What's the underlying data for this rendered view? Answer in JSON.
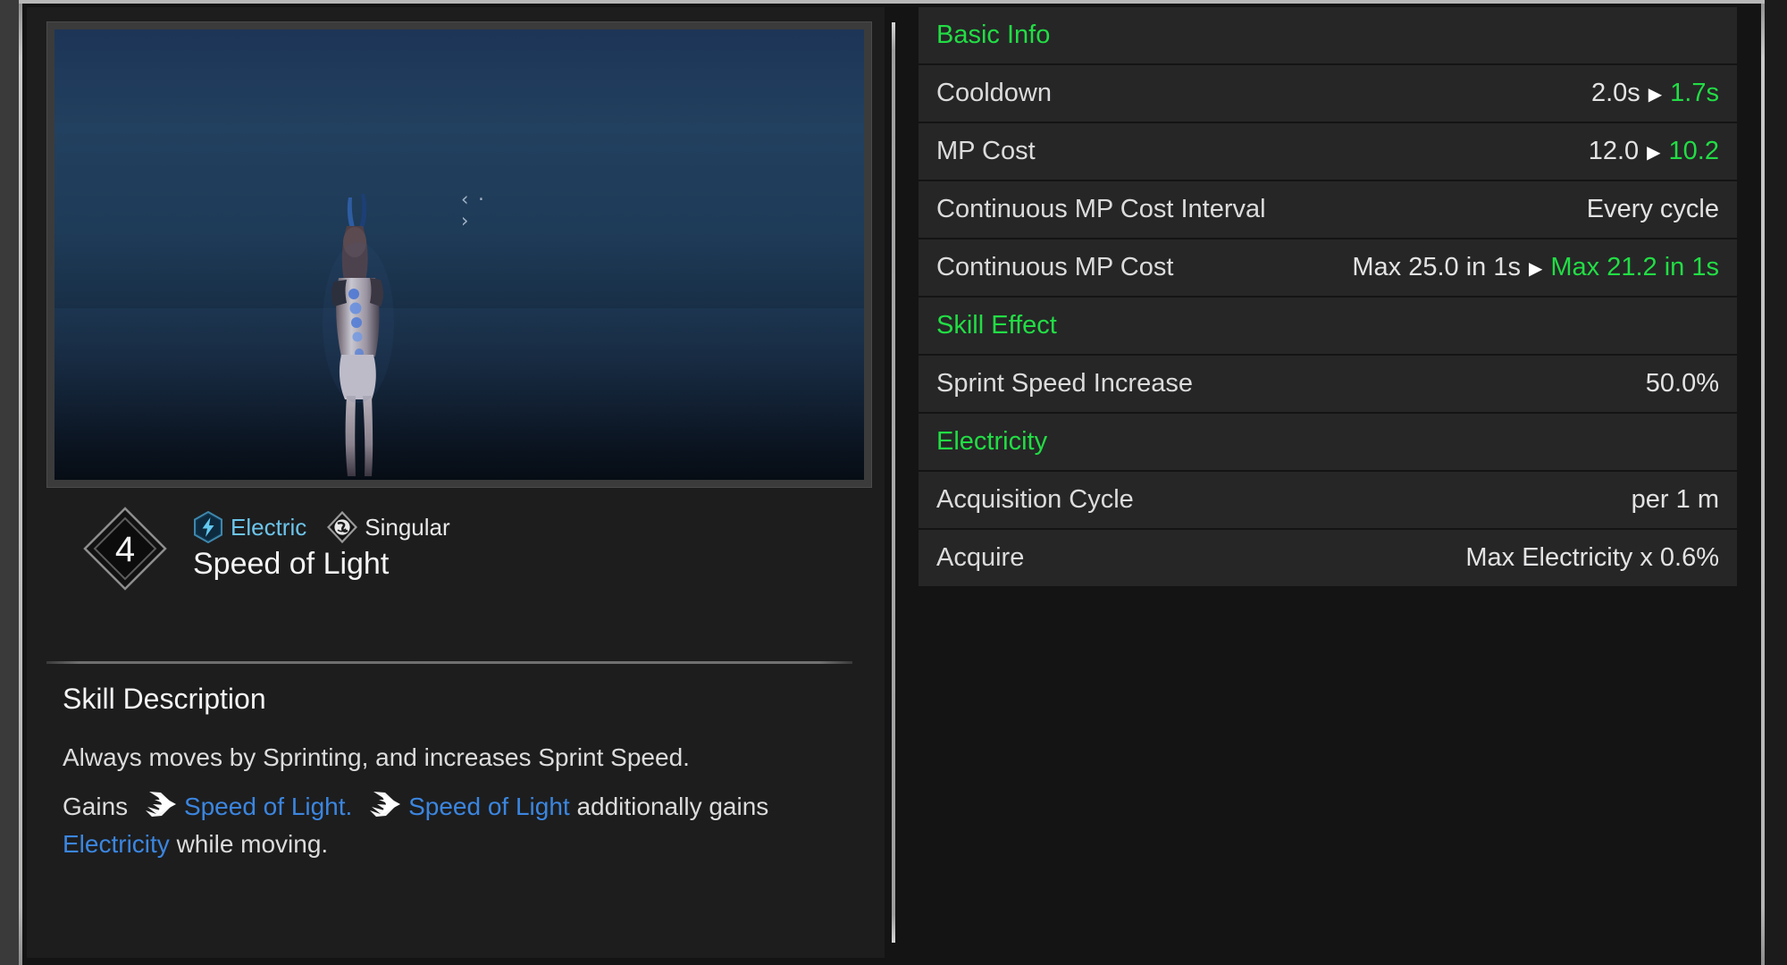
{
  "preview": {
    "name": "skill-preview-video",
    "reticle": "‹ · ›",
    "background_top": "#1d3557",
    "background_bottom": "#070d15"
  },
  "skill": {
    "rank": "4",
    "title": "Speed of Light",
    "tags": [
      {
        "icon": "electric-hexagon-icon",
        "label": "Electric",
        "color": "#6cc4ea"
      },
      {
        "icon": "singular-diamond-icon",
        "label": "Singular",
        "color": "#e9e9e9"
      }
    ],
    "description_heading": "Skill Description",
    "paragraph_1": "Always moves by Sprinting, and increases Sprint Speed.",
    "paragraph_2": {
      "prefix": "Gains",
      "buff_1": "Speed of Light.",
      "buff_2": "Speed of Light",
      "middle": "additionally gains",
      "keyword": "Electricity",
      "suffix": "while moving."
    }
  },
  "colors": {
    "section_green": "#22dd44",
    "link_blue": "#3b86e0",
    "electric_blue": "#6cc4ea",
    "row_background": "#262627",
    "panel_background": "#1d1d1e"
  },
  "stats": [
    {
      "type": "section",
      "label": "Basic Info",
      "value": "",
      "value_new": ""
    },
    {
      "type": "row",
      "label": "Cooldown",
      "value": "2.0s",
      "value_new": "1.7s"
    },
    {
      "type": "row",
      "label": "MP Cost",
      "value": "12.0",
      "value_new": "10.2"
    },
    {
      "type": "row",
      "label": "Continuous MP Cost Interval",
      "value": "Every cycle",
      "value_new": ""
    },
    {
      "type": "row",
      "label": "Continuous MP Cost",
      "value": "Max 25.0 in 1s",
      "value_new": "Max 21.2 in 1s"
    },
    {
      "type": "section",
      "label": "Skill Effect",
      "value": "",
      "value_new": ""
    },
    {
      "type": "row",
      "label": "Sprint Speed Increase",
      "value": "50.0%",
      "value_new": ""
    },
    {
      "type": "section",
      "label": "Electricity",
      "value": "",
      "value_new": ""
    },
    {
      "type": "row",
      "label": "Acquisition Cycle",
      "value": "per 1 m",
      "value_new": ""
    },
    {
      "type": "row",
      "label": "Acquire",
      "value": "Max Electricity x 0.6%",
      "value_new": ""
    }
  ]
}
